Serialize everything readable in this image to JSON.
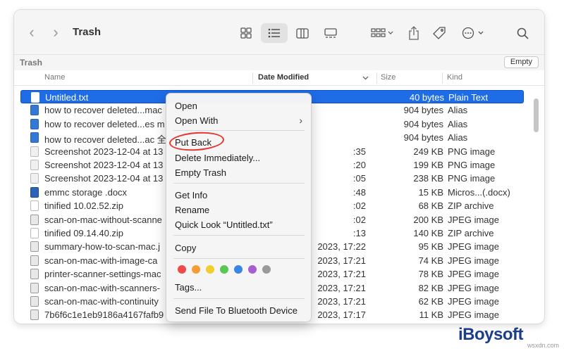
{
  "window": {
    "title": "Trash"
  },
  "pathbar": {
    "title": "Trash",
    "empty_label": "Empty"
  },
  "columns": {
    "name": "Name",
    "date": "Date Modified",
    "size": "Size",
    "kind": "Kind"
  },
  "rows": [
    {
      "name": "Untitled.txt",
      "date": "",
      "size": "40 bytes",
      "kind": "Plain Text",
      "icon": "text-file-icon"
    },
    {
      "name": "how to recover deleted...mac",
      "date": "",
      "size": "904 bytes",
      "kind": "Alias",
      "icon": "alias-icon"
    },
    {
      "name": "how to recover deleted...es m",
      "date": "",
      "size": "904 bytes",
      "kind": "Alias",
      "icon": "alias-icon"
    },
    {
      "name": "how to recover deleted...ac 全",
      "date": "",
      "size": "904 bytes",
      "kind": "Alias",
      "icon": "alias-icon"
    },
    {
      "name": "Screenshot 2023-12-04 at 13",
      "date": ":35",
      "size": "249 KB",
      "kind": "PNG image",
      "icon": "png-icon"
    },
    {
      "name": "Screenshot 2023-12-04 at 13",
      "date": ":20",
      "size": "199 KB",
      "kind": "PNG image",
      "icon": "png-icon"
    },
    {
      "name": "Screenshot 2023-12-04 at 13",
      "date": ":05",
      "size": "238 KB",
      "kind": "PNG image",
      "icon": "png-icon"
    },
    {
      "name": "emmc storage         .docx",
      "date": ":48",
      "size": "15 KB",
      "kind": "Micros...(.docx)",
      "icon": "word-doc-icon"
    },
    {
      "name": "tinified 10.02.52.zip",
      "date": ":02",
      "size": "68 KB",
      "kind": "ZIP archive",
      "icon": "zip-icon"
    },
    {
      "name": "scan-on-mac-without-scanne",
      "date": ":02",
      "size": "200 KB",
      "kind": "JPEG image",
      "icon": "jpeg-icon"
    },
    {
      "name": "tinified 09.14.40.zip",
      "date": ":13",
      "size": "140 KB",
      "kind": "ZIP archive",
      "icon": "zip-icon"
    },
    {
      "name": "summary-how-to-scan-mac.j",
      "date": "2023, 17:22",
      "size": "95 KB",
      "kind": "JPEG image",
      "icon": "jpeg-icon"
    },
    {
      "name": "scan-on-mac-with-image-ca",
      "date": "2023, 17:21",
      "size": "74 KB",
      "kind": "JPEG image",
      "icon": "jpeg-icon"
    },
    {
      "name": "printer-scanner-settings-mac",
      "date": "2023, 17:21",
      "size": "78 KB",
      "kind": "JPEG image",
      "icon": "jpeg-icon"
    },
    {
      "name": "scan-on-mac-with-scanners-",
      "date": "2023, 17:21",
      "size": "82 KB",
      "kind": "JPEG image",
      "icon": "jpeg-icon"
    },
    {
      "name": "scan-on-mac-with-continuity",
      "date": "2023, 17:21",
      "size": "62 KB",
      "kind": "JPEG image",
      "icon": "jpeg-icon"
    },
    {
      "name": "7b6f6c1e1eb9186a4167fafb9",
      "date": "2023, 17:17",
      "size": "11 KB",
      "kind": "JPEG image",
      "icon": "jpeg-icon"
    }
  ],
  "context_menu": {
    "open": "Open",
    "open_with": "Open With",
    "put_back": "Put Back",
    "delete_immediately": "Delete Immediately...",
    "empty_trash": "Empty Trash",
    "get_info": "Get Info",
    "rename": "Rename",
    "quick_look": "Quick Look “Untitled.txt”",
    "copy": "Copy",
    "tags": "Tags...",
    "send_bluetooth": "Send File To Bluetooth Device",
    "tag_colors": [
      "#ee4a4a",
      "#f59c34",
      "#f2cd2e",
      "#5ac653",
      "#3a86e5",
      "#a65fd1",
      "#9a9a9a"
    ]
  },
  "watermark": {
    "brand": "iBoysoft",
    "site": "wsxdn.com"
  }
}
